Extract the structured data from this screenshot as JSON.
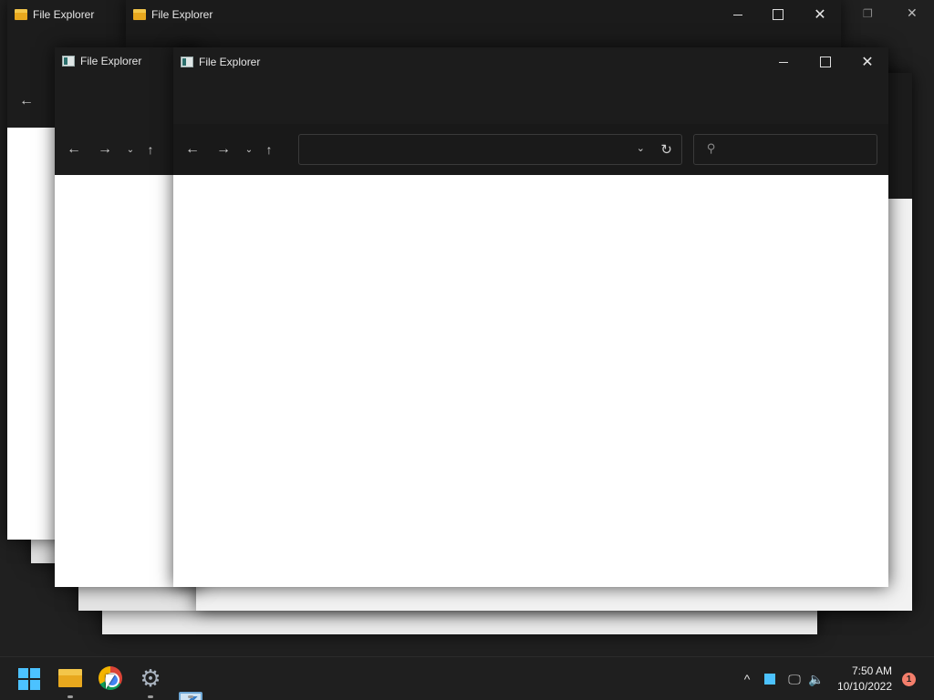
{
  "windows": {
    "back1": {
      "title": "File Explorer"
    },
    "back2": {
      "title": "File Explorer"
    },
    "mid": {
      "title": "File Explorer"
    },
    "front": {
      "title": "File Explorer"
    }
  },
  "icons": {
    "back": "arrow-left-icon",
    "forward": "arrow-right-icon",
    "recent": "chevron-down-icon",
    "up": "arrow-up-icon",
    "refresh": "refresh-icon",
    "search": "search-icon",
    "minimize": "minimize-icon",
    "maximize": "maximize-icon",
    "close": "close-icon"
  },
  "taskbar": {
    "apps": [
      "start",
      "file-explorer",
      "chrome",
      "settings",
      "resource-monitor"
    ],
    "time": "7:50 AM",
    "date": "10/10/2022",
    "notifications": "1"
  },
  "colors": {
    "accent": "#4cc2ff",
    "titlebar": "#1c1c1c",
    "notification": "#f37e6b"
  }
}
